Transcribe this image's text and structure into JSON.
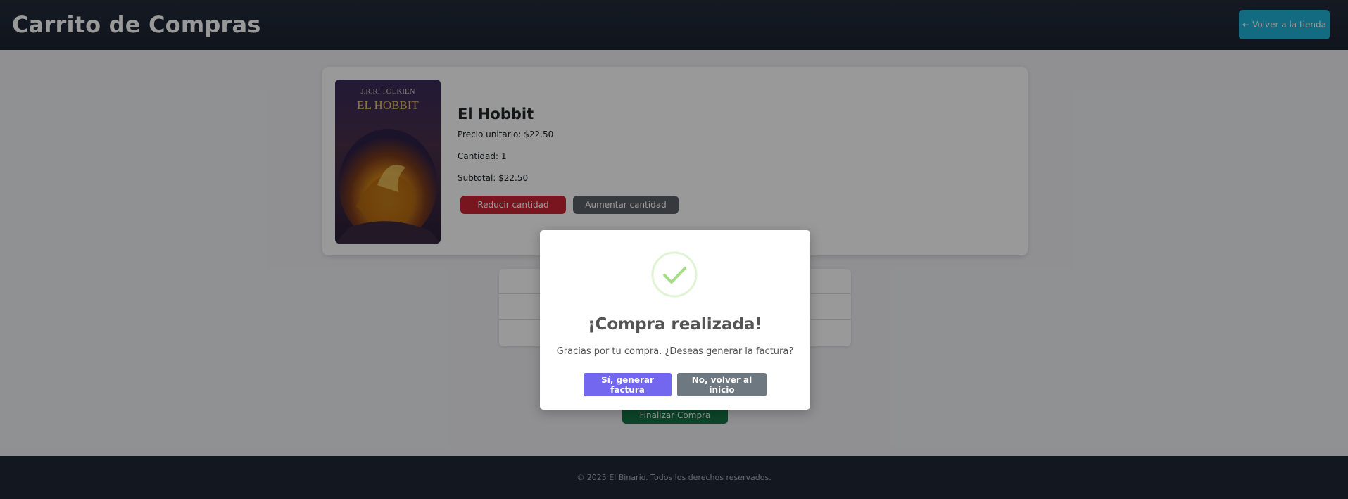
{
  "header": {
    "title": "Carrito de Compras",
    "back_button": "Volver a la tienda",
    "back_icon": "arrow-left-icon"
  },
  "cart_item": {
    "cover": {
      "author": "J.R.R. TOLKIEN",
      "title": "EL HOBBIT"
    },
    "name": "El Hobbit",
    "unit_price": "Precio unitario: $22.50",
    "quantity": "Cantidad: 1",
    "subtotal": "Subtotal: $22.50",
    "decrease_button": "Reducir cantidad",
    "increase_button": "Aumentar cantidad"
  },
  "finish_button": "Finalizar Compra",
  "footer": {
    "text": "© 2025 El Binario. Todos los derechos reservados."
  },
  "modal": {
    "icon": "success-check-icon",
    "title": "¡Compra realizada!",
    "text": "Gracias por tu compra. ¿Deseas generar la factura?",
    "confirm_button": "Sí, generar factura",
    "deny_button": "No, volver al inicio"
  },
  "colors": {
    "header_bg": "#1b2231",
    "accent": "#1fb3d6",
    "danger": "#c82333",
    "secondary": "#5a6268",
    "success": "#157347",
    "confirm": "#7367f0",
    "deny": "#6e7881",
    "check": "#a5dc86"
  }
}
